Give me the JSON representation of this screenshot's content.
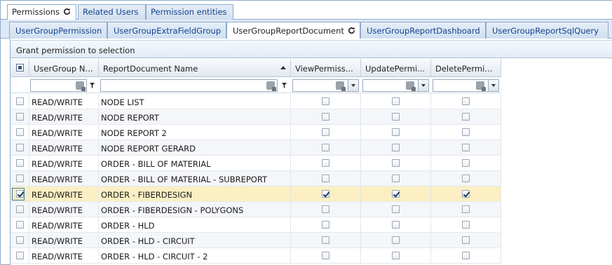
{
  "top_tabs": [
    {
      "label": "Permissions",
      "active": true
    },
    {
      "label": "Related Users",
      "active": false
    },
    {
      "label": "Permission entities",
      "active": false
    }
  ],
  "sub_tabs": [
    {
      "label": "UserGroupPermission",
      "active": false
    },
    {
      "label": "UserGroupExtraFieldGroup",
      "active": false
    },
    {
      "label": "UserGroupReportDocument",
      "active": true
    },
    {
      "label": "UserGroupReportDashboard",
      "active": false
    },
    {
      "label": "UserGroupReportSqlQuery",
      "active": false
    }
  ],
  "toolbar": {
    "grant_label": "Grant permission to selection"
  },
  "grid": {
    "columns": {
      "usergroup": "UserGroup N...",
      "reportdoc": "ReportDocument Name",
      "view": "ViewPermiss...",
      "update": "UpdatePermi...",
      "delete": "DeletePermi..."
    },
    "sort_column": "ReportDocument Name",
    "rows": [
      {
        "group": "READ/WRITE",
        "name": "NODE LIST",
        "selected": false,
        "view": false,
        "update": false,
        "delete": false
      },
      {
        "group": "READ/WRITE",
        "name": "NODE REPORT",
        "selected": false,
        "view": false,
        "update": false,
        "delete": false
      },
      {
        "group": "READ/WRITE",
        "name": "NODE REPORT 2",
        "selected": false,
        "view": false,
        "update": false,
        "delete": false
      },
      {
        "group": "READ/WRITE",
        "name": "NODE REPORT GERARD",
        "selected": false,
        "view": false,
        "update": false,
        "delete": false
      },
      {
        "group": "READ/WRITE",
        "name": "ORDER - BILL OF MATERIAL",
        "selected": false,
        "view": false,
        "update": false,
        "delete": false
      },
      {
        "group": "READ/WRITE",
        "name": "ORDER - BILL OF MATERIAL - SUBREPORT",
        "selected": false,
        "view": false,
        "update": false,
        "delete": false
      },
      {
        "group": "READ/WRITE",
        "name": "ORDER - FIBERDESIGN",
        "selected": true,
        "view": true,
        "update": true,
        "delete": true
      },
      {
        "group": "READ/WRITE",
        "name": "ORDER - FIBERDESIGN - POLYGONS",
        "selected": false,
        "view": false,
        "update": false,
        "delete": false
      },
      {
        "group": "READ/WRITE",
        "name": "ORDER - HLD",
        "selected": false,
        "view": false,
        "update": false,
        "delete": false
      },
      {
        "group": "READ/WRITE",
        "name": "ORDER - HLD - CIRCUIT",
        "selected": false,
        "view": false,
        "update": false,
        "delete": false
      },
      {
        "group": "READ/WRITE",
        "name": "ORDER - HLD - CIRCUIT - 2",
        "selected": false,
        "view": false,
        "update": false,
        "delete": false
      }
    ]
  },
  "colors": {
    "accent_border": "#8fa9c8",
    "selected_row": "#fbefc3",
    "tab_text": "#15428b"
  }
}
